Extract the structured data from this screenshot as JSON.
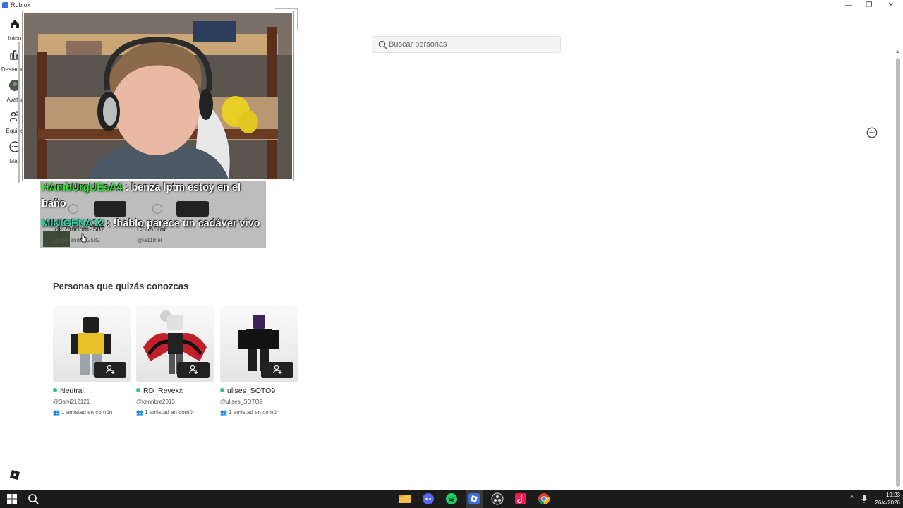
{
  "window": {
    "title": "Roblox",
    "controls": [
      "—",
      "❐",
      "✕"
    ]
  },
  "sidebar": {
    "items": [
      {
        "label": "Inicio",
        "icon": "home-icon"
      },
      {
        "label": "Destacado",
        "icon": "chart-icon"
      },
      {
        "label": "Avatar",
        "icon": "avatar-icon"
      },
      {
        "label": "Equipo",
        "icon": "group-icon"
      },
      {
        "label": "Más",
        "icon": "more-icon"
      }
    ]
  },
  "search": {
    "placeholder": "Buscar personas"
  },
  "friends": [
    {
      "name": "IdkRandom2582",
      "handle": "@IdkRandom2582"
    },
    {
      "name": "CoflaStar",
      "handle": "@la11mel"
    }
  ],
  "chat": [
    {
      "user": "HAmbUrgUEsA4",
      "sep": " : ",
      "text": "benza lptm estoy en el",
      "cont": "baño"
    },
    {
      "user": "MINIGENA12",
      "sep": " : ",
      "text": "!hablo parece un cadáver vivo"
    }
  ],
  "suggestions": {
    "title": "Personas que quizás conozcas",
    "people": [
      {
        "name": "Neutral",
        "handle": "@Salvi212121",
        "mutual": "1 amistad en común"
      },
      {
        "name": "RD_Reyexx",
        "handle": "@kennbre2013",
        "mutual": "1 amistad en común"
      },
      {
        "name": "ulises_SOTO9",
        "handle": "@ulises_SOTO9",
        "mutual": "1 amistad en común"
      }
    ]
  },
  "taskbar": {
    "time": "19:23",
    "date": "26/4/2026",
    "apps": [
      "file-explorer-icon",
      "discord-icon",
      "spotify-icon",
      "roblox-icon",
      "obs-icon",
      "tiktok-icon",
      "chrome-icon"
    ]
  },
  "colors": {
    "online": "#3cc486",
    "chat_user_green": "#37e13a",
    "chat_user_teal": "#2ed4a6",
    "taskbar": "#1c1c1c"
  }
}
